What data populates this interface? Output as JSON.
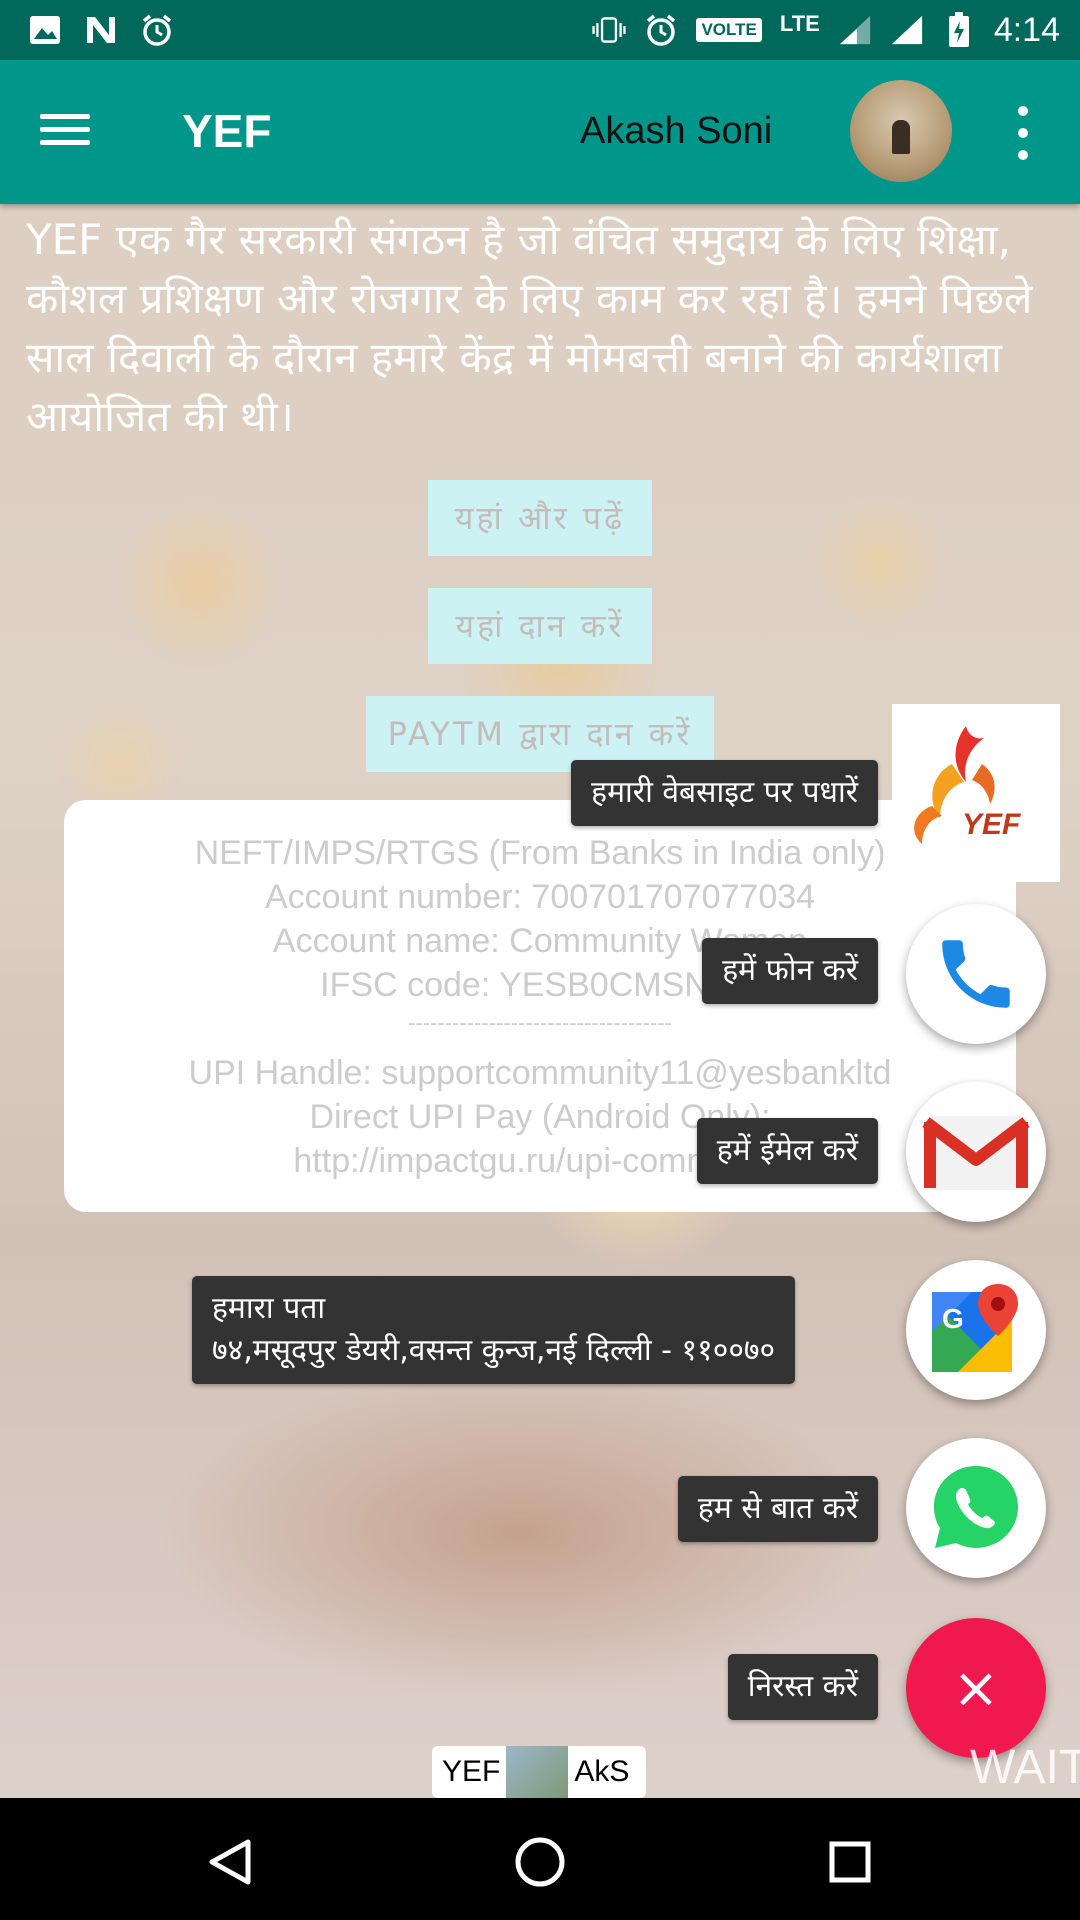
{
  "status_bar": {
    "time": "4:14",
    "volte": "VOLTE",
    "network": "LTE",
    "icons": [
      "image-icon",
      "n-icon",
      "alarm-icon",
      "vibrate-icon",
      "alarm-icon",
      "signal-icon",
      "signal-icon",
      "battery-charging-icon"
    ]
  },
  "app_bar": {
    "title": "YEF",
    "user_name": "Akash Soni"
  },
  "content": {
    "about": "YEF एक गैर सरकारी संगठन है जो वंचित समुदाय के लिए शिक्षा, कौशल प्रशिक्षण और रोजगार के लिए काम कर रहा है। हमने पिछले साल दिवाली के दौरान हमारे केंद्र में मोमबत्ती बनाने की कार्यशाला आयोजित की थी।",
    "read_more": "यहां और पढ़ें",
    "donate": "यहां दान करें",
    "donate_paytm": "PAYTM द्वारा दान करें",
    "bank_info": {
      "line1": "NEFT/IMPS/RTGS (From Banks in India only)",
      "line2": "Account number: 700701707077034",
      "line3": "Account name: Community Women",
      "line4": "IFSC code: YESB0CMSNOC",
      "separator": "------------------------------------",
      "line5": "UPI Handle: supportcommunity11@yesbankltd",
      "line6": "Direct UPI Pay (Android Only):",
      "line7": "http://impactgu.ru/upi-community"
    }
  },
  "fab_menu": {
    "website_label": "हमारी वेबसाइट पर पधारें",
    "call_label": "हमें फोन करें",
    "email_label": "हमें ईमेल करें",
    "address_title": "हमारा पता",
    "address_value": "७४,मसूदपुर डेयरी,वसन्त कुन्ज,नई दिल्ली - ११००७०",
    "chat_label": "हम से बात करें",
    "cancel_label": "निरस्त करें",
    "close_symbol": "×",
    "logo_text": "YEF"
  },
  "footer": {
    "chip_left": "YEF",
    "chip_right": "AkS",
    "wait_text": "WAIT"
  },
  "colors": {
    "status_bar": "#00695c",
    "app_bar": "#00968a",
    "fab_close": "#f0194f",
    "label_bg": "#333333",
    "button_bg": "#c9f1f4"
  }
}
